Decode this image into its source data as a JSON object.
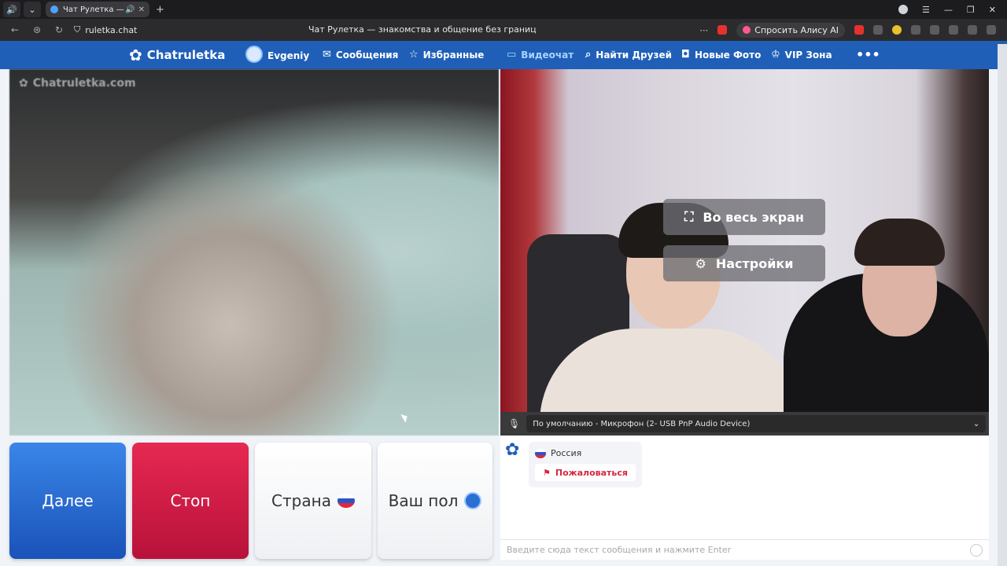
{
  "browser": {
    "tab_title": "Чат Рулетка — знак",
    "url": "ruletka.chat",
    "page_title": "Чат Рулетка — знакомства и общение без границ",
    "alisa_label": "Спросить Алису AI"
  },
  "site": {
    "logo": "Chatruletka",
    "user": "Evgeniy",
    "nav": {
      "messages": "Сообщения",
      "favorites": "Избранные",
      "videochat": "Видеочат",
      "find_friends": "Найти Друзей",
      "new_photos": "Новые Фото",
      "vip": "VIP Зона"
    },
    "accent_color": "#1f5fb8"
  },
  "video": {
    "watermark": "Chatruletka.com",
    "fullscreen_label": "Во весь экран",
    "settings_label": "Настройки",
    "mic_device": "По умолчанию - Микрофон (2- USB PnP Audio Device)"
  },
  "controls": {
    "next_label": "Далее",
    "stop_label": "Стоп",
    "country_label": "Страна",
    "gender_label": "Ваш пол"
  },
  "chat": {
    "country_name": "Россия",
    "report_label": "Пожаловаться",
    "input_placeholder": "Введите сюда текст сообщения и нажмите Enter"
  }
}
